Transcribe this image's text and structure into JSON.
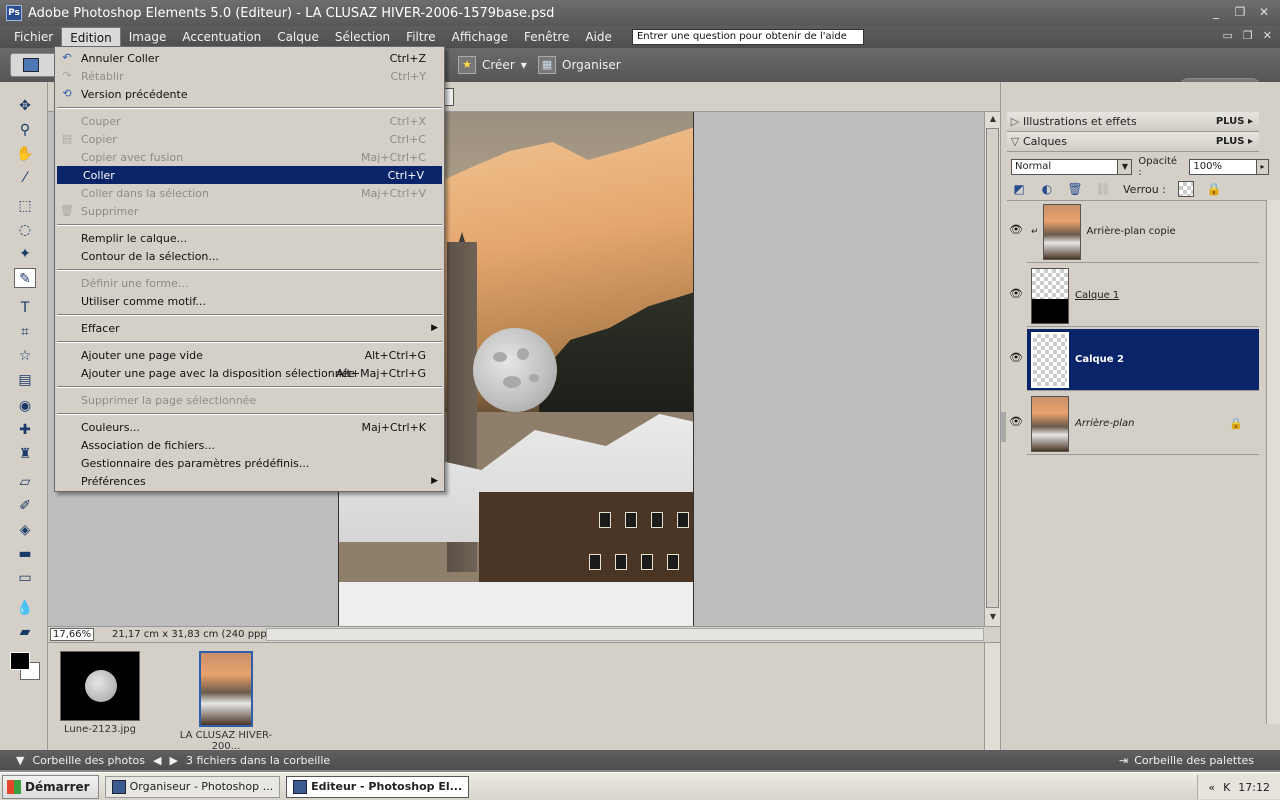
{
  "window": {
    "title": "Adobe Photoshop Elements 5.0 (Editeur) - LA CLUSAZ HIVER-2006-1579base.psd",
    "app_icon_label": "Ps"
  },
  "menubar": {
    "items": [
      "Fichier",
      "Edition",
      "Image",
      "Accentuation",
      "Calque",
      "Sélection",
      "Filtre",
      "Affichage",
      "Fenêtre",
      "Aide"
    ],
    "active": "Edition",
    "help_text": "Entrer une question pour obtenir de l'aide"
  },
  "optionsbar": {
    "create_label": "Créer",
    "organize_label": "Organiser"
  },
  "edit_menu": {
    "items": [
      {
        "label": "Annuler Coller",
        "shortcut": "Ctrl+Z",
        "icon": "undo-icon",
        "state": "enabled"
      },
      {
        "label": "Rétablir",
        "shortcut": "Ctrl+Y",
        "icon": "redo-icon",
        "state": "disabled"
      },
      {
        "label": "Version précédente",
        "shortcut": "",
        "icon": "revert-icon",
        "state": "enabled"
      },
      {
        "sep": true
      },
      {
        "label": "Couper",
        "shortcut": "Ctrl+X",
        "icon": "",
        "state": "disabled"
      },
      {
        "label": "Copier",
        "shortcut": "Ctrl+C",
        "icon": "copy-icon",
        "state": "disabled"
      },
      {
        "label": "Copier avec fusion",
        "shortcut": "Maj+Ctrl+C",
        "icon": "",
        "state": "disabled"
      },
      {
        "label": "Coller",
        "shortcut": "Ctrl+V",
        "icon": "",
        "state": "highlighted"
      },
      {
        "label": "Coller dans la sélection",
        "shortcut": "Maj+Ctrl+V",
        "icon": "",
        "state": "disabled"
      },
      {
        "label": "Supprimer",
        "shortcut": "",
        "icon": "trash-icon",
        "state": "disabled"
      },
      {
        "sep": true
      },
      {
        "label": "Remplir le calque...",
        "shortcut": "",
        "icon": "",
        "state": "enabled"
      },
      {
        "label": "Contour de la sélection...",
        "shortcut": "",
        "icon": "",
        "state": "enabled"
      },
      {
        "sep": true
      },
      {
        "label": "Définir une forme...",
        "shortcut": "",
        "icon": "",
        "state": "disabled"
      },
      {
        "label": "Utiliser comme motif...",
        "shortcut": "",
        "icon": "",
        "state": "enabled"
      },
      {
        "sep": true
      },
      {
        "label": "Effacer",
        "shortcut": "",
        "icon": "",
        "state": "enabled",
        "submenu": true
      },
      {
        "sep": true
      },
      {
        "label": "Ajouter une page vide",
        "shortcut": "Alt+Ctrl+G",
        "icon": "",
        "state": "enabled"
      },
      {
        "label": "Ajouter une page avec la disposition sélectionnée",
        "shortcut": "Alt+Maj+Ctrl+G",
        "icon": "",
        "state": "enabled"
      },
      {
        "sep": true
      },
      {
        "label": "Supprimer la page sélectionnée",
        "shortcut": "",
        "icon": "",
        "state": "disabled"
      },
      {
        "sep": true
      },
      {
        "label": "Couleurs...",
        "shortcut": "Maj+Ctrl+K",
        "icon": "",
        "state": "enabled"
      },
      {
        "label": "Association de fichiers...",
        "shortcut": "",
        "icon": "",
        "state": "enabled"
      },
      {
        "label": "Gestionnaire des paramètres prédéfinis...",
        "shortcut": "",
        "icon": "",
        "state": "enabled"
      },
      {
        "label": "Préférences",
        "shortcut": "",
        "icon": "",
        "state": "enabled",
        "submenu": true
      }
    ]
  },
  "status": {
    "zoom": "17,66%",
    "dimensions": "21,17 cm x 31,83 cm (240 ppp)"
  },
  "photo_bin": {
    "items": [
      {
        "label": "Lune-2123.jpg",
        "selected": false
      },
      {
        "label": "LA CLUSAZ HIVER-200...",
        "selected": true
      }
    ],
    "bar_label": "Corbeille des photos",
    "count_text": "3 fichiers dans la corbeille",
    "palettes_label": "Corbeille des palettes"
  },
  "panels": {
    "effects_title": "Illustrations et effets",
    "layers_title": "Calques",
    "plus_label": "PLUS",
    "blend_mode": "Normal",
    "opacity_label": "Opacité :",
    "opacity_value": "100%",
    "lock_label": "Verrou :"
  },
  "layers": [
    {
      "name": "Arrière-plan copie",
      "style": "normal",
      "thumb": "photo",
      "selected": false,
      "locked": false
    },
    {
      "name": "Calque 1",
      "style": "underline",
      "thumb": "mask",
      "selected": false,
      "locked": false
    },
    {
      "name": "Calque 2",
      "style": "bold",
      "thumb": "checker",
      "selected": true,
      "locked": false
    },
    {
      "name": "Arrière-plan",
      "style": "italic",
      "thumb": "photo",
      "selected": false,
      "locked": true
    }
  ],
  "taskbar": {
    "start": "Démarrer",
    "tasks": [
      {
        "label": "Organiseur - Photoshop ...",
        "active": false
      },
      {
        "label": "Editeur - Photoshop El...",
        "active": true
      }
    ],
    "time": "17:12"
  },
  "colors": {
    "menu_highlight": "#0a246a",
    "selected_layer": "#0a246a",
    "menu_bg": "#d4d0c8"
  }
}
